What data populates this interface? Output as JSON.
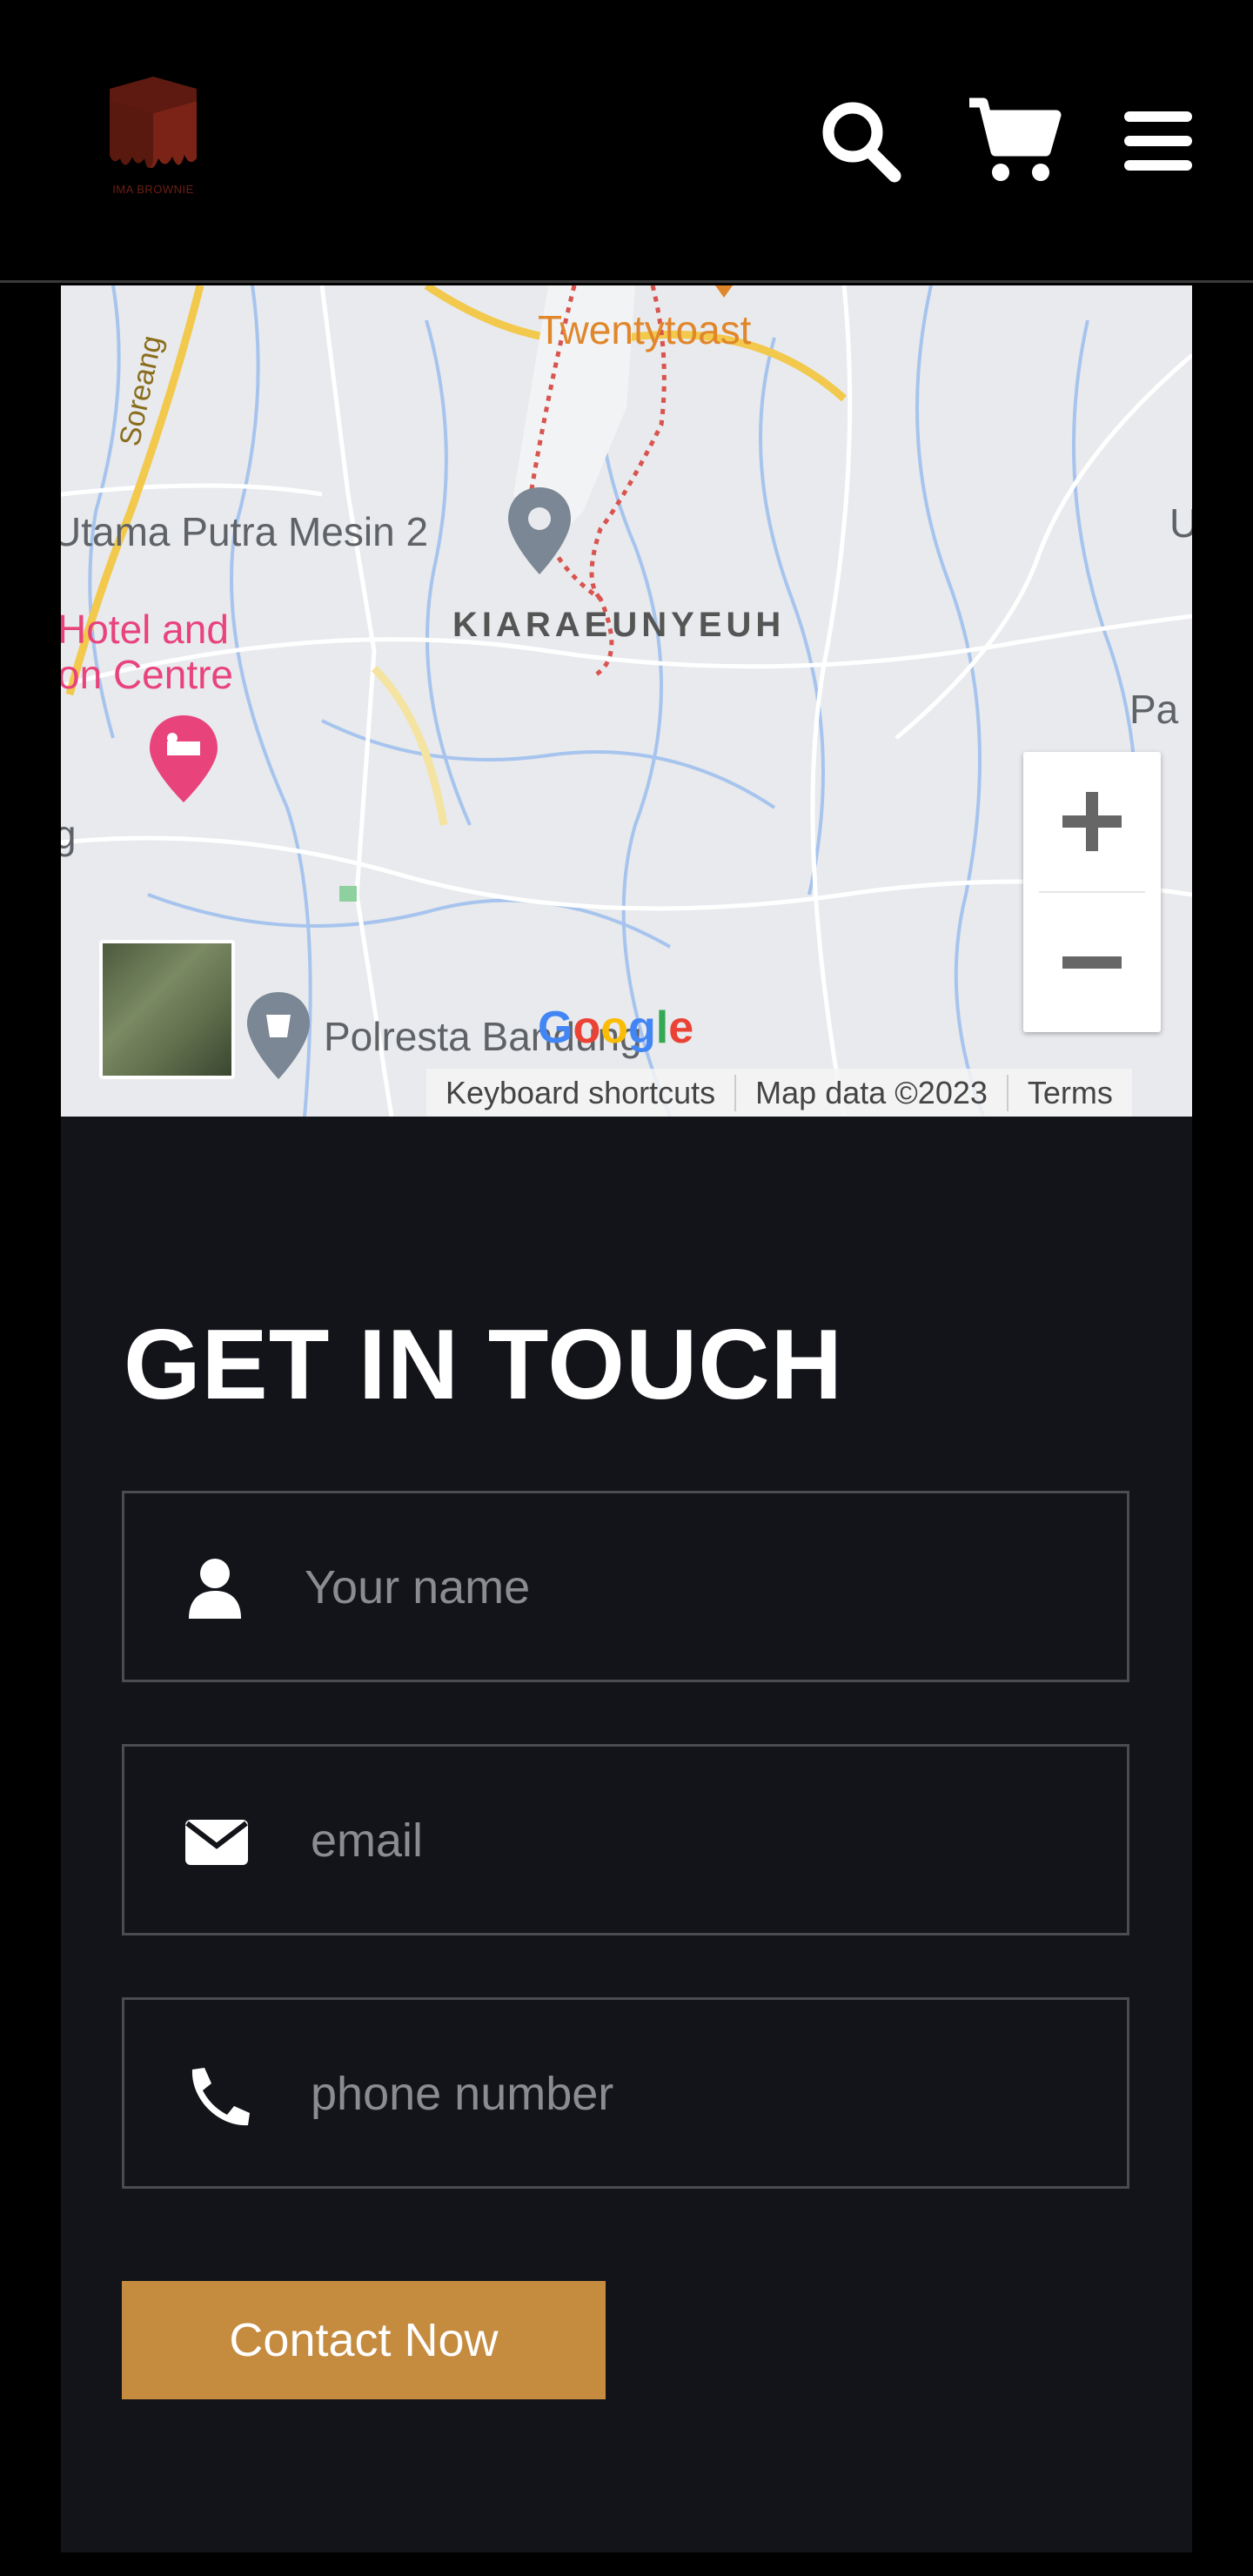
{
  "header": {
    "logo_text": "IMA BROWNIE",
    "icons": [
      "search-icon",
      "cart-icon",
      "menu-icon"
    ]
  },
  "map": {
    "labels": {
      "twentytoast": "Twentytoast",
      "soreang": "Soreang",
      "utama": "Utama Putra Mesin 2",
      "kiaraeunyeuh": "KIARAEUNYEUH",
      "hotel_line1": "Hotel and",
      "hotel_line2": "on Centre",
      "polresta": "Polresta Bandung",
      "edge_right_1": "U",
      "edge_right_2": "Pa",
      "edge_left": "g"
    },
    "google_logo": "Google",
    "attribution": {
      "keyboard": "Keyboard shortcuts",
      "mapdata": "Map data ©2023",
      "terms": "Terms"
    },
    "colors": {
      "accent_orange": "#e0862b",
      "pink": "#e8437b",
      "river": "#a7c4ee"
    }
  },
  "contact": {
    "title": "GET IN TOUCH",
    "fields": [
      {
        "icon": "user-icon",
        "placeholder": "Your name"
      },
      {
        "icon": "envelope-icon",
        "placeholder": "email"
      },
      {
        "icon": "phone-icon",
        "placeholder": "phone number"
      }
    ],
    "button_label": "Contact Now",
    "button_color": "#c58b3f"
  }
}
